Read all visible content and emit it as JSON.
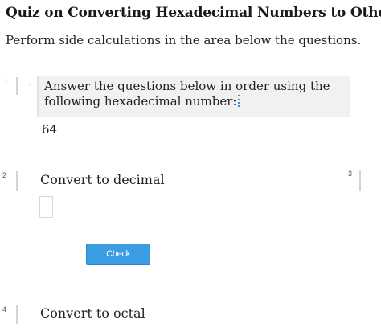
{
  "header": {
    "title": "Quiz on Converting Hexadecimal Numbers to Other Sys",
    "subtitle": "Perform side calculations in the area below the questions."
  },
  "questions": [
    {
      "number": "1",
      "text": "Answer the questions below in order using the following hexadecimal number:",
      "value": "64"
    },
    {
      "number": "2",
      "text": "Convert to decimal",
      "answer": "",
      "check_label": "Check"
    },
    {
      "number": "3"
    },
    {
      "number": "4",
      "text": "Convert to octal"
    }
  ],
  "colors": {
    "check_button": "#3b9be3",
    "marker": "#e0a012",
    "cursor": "#3a8dde"
  }
}
